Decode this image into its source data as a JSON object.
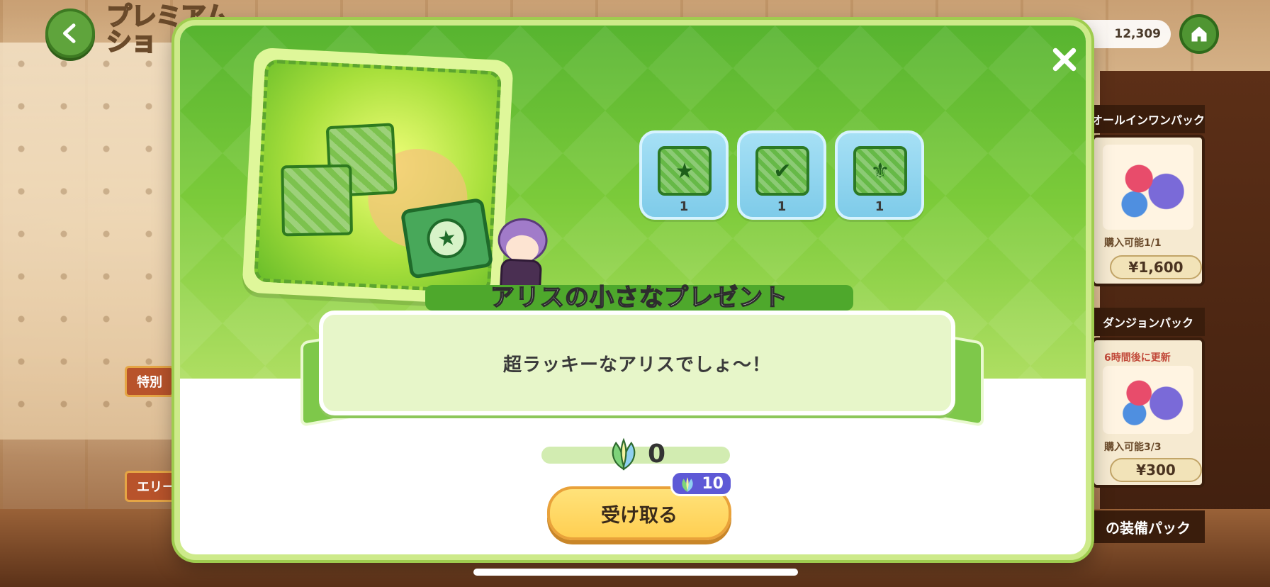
{
  "shop": {
    "title_line1": "プレミアム",
    "title_line2": "ショ",
    "currency_amount": "12,309",
    "side_labels": [
      "特別",
      "エリー"
    ],
    "packs": [
      {
        "title": "オールインワンパック",
        "limit": "購入可能1/1",
        "price": "¥1,600"
      },
      {
        "title": "ダンジョンパック",
        "refresh": "6時間後に更新",
        "limit": "購入可能3/3",
        "price": "¥300"
      },
      {
        "title": "の装備パック"
      }
    ]
  },
  "modal": {
    "title": "アリスの小さなプレゼント",
    "description": "超ラッキーなアリスでしょ～！",
    "items": [
      {
        "icon": "star-ticket-icon",
        "count": "1"
      },
      {
        "icon": "potion-ticket-stack-icon",
        "count": "1"
      },
      {
        "icon": "trident-ticket-stack-icon",
        "count": "1"
      }
    ],
    "owned_amount": "0",
    "cost": "10",
    "receive_label": "受け取る"
  },
  "colors": {
    "modal_green": "#57b430",
    "button_yellow": "#ffcf52",
    "badge_purple": "#5e59d6"
  }
}
